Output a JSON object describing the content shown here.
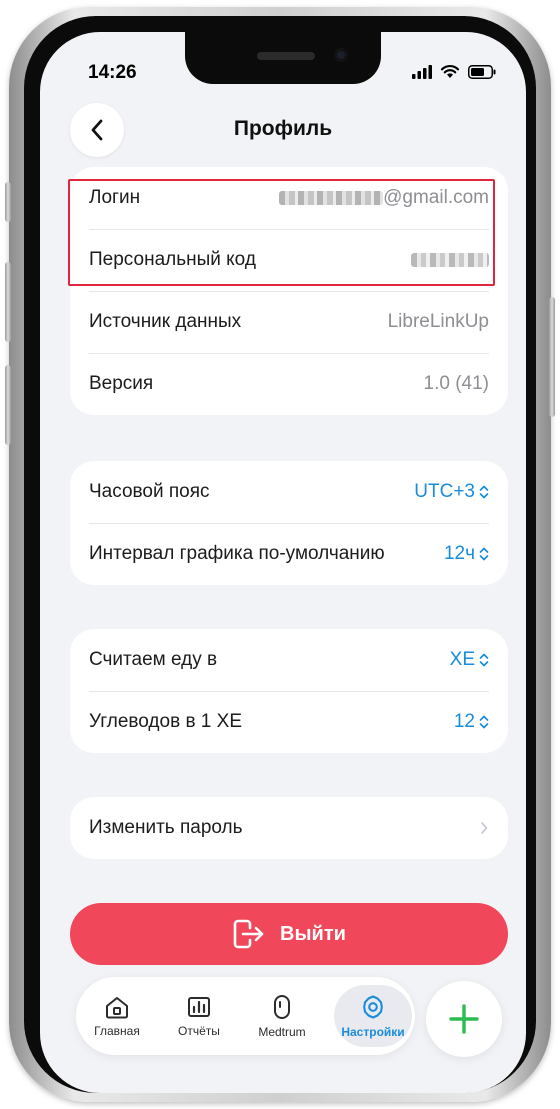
{
  "status_bar": {
    "time": "14:26"
  },
  "header": {
    "title": "Профиль"
  },
  "account_card": {
    "login": {
      "label": "Логин",
      "value_suffix": "@gmail.com"
    },
    "personal_code": {
      "label": "Персональный код"
    },
    "data_source": {
      "label": "Источник данных",
      "value": "LibreLinkUp"
    },
    "version": {
      "label": "Версия",
      "value": "1.0 (41)"
    }
  },
  "display_card": {
    "timezone": {
      "label": "Часовой пояс",
      "value": "UTC+3"
    },
    "chart_interval": {
      "label": "Интервал графика по-умолчанию",
      "value": "12ч"
    }
  },
  "food_card": {
    "count_food_in": {
      "label": "Считаем еду в",
      "value": "ХЕ"
    },
    "carbs_per_xe": {
      "label": "Углеводов в 1 ХЕ",
      "value": "12"
    }
  },
  "password_card": {
    "change_password": {
      "label": "Изменить пароль"
    }
  },
  "logout_button": {
    "label": "Выйти"
  },
  "tab_bar": {
    "tabs": [
      {
        "label": "Главная",
        "icon": "home-icon"
      },
      {
        "label": "Отчёты",
        "icon": "reports-icon"
      },
      {
        "label": "Medtrum",
        "icon": "device-icon"
      },
      {
        "label": "Настройки",
        "icon": "gear-icon",
        "active": true
      }
    ]
  },
  "colors": {
    "accent": "#1a8cdc",
    "danger": "#f0475a",
    "add": "#2ebc4f",
    "highlight": "#e0253f",
    "background": "#f2f3f6"
  }
}
